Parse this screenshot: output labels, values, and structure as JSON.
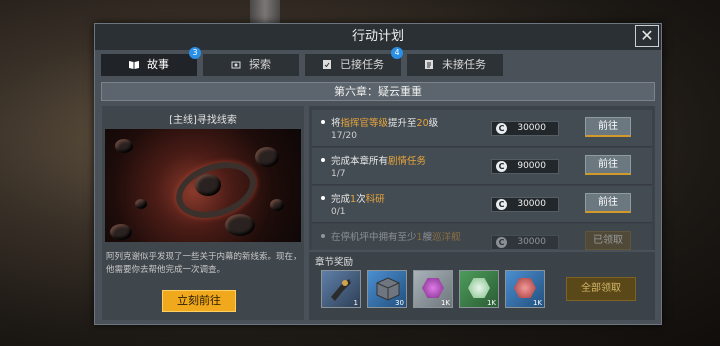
{
  "window": {
    "title": "行动计划",
    "close_icon": "close-icon"
  },
  "tabs": [
    {
      "label": "故事",
      "icon": "book-icon",
      "badge": "3",
      "active": true
    },
    {
      "label": "探索",
      "icon": "explore-icon",
      "badge": "",
      "active": false
    },
    {
      "label": "已接任务",
      "icon": "clipboard-check-icon",
      "badge": "4",
      "active": false
    },
    {
      "label": "未接任务",
      "icon": "clipboard-list-icon",
      "badge": "",
      "active": false
    }
  ],
  "chapter": {
    "title": "第六章：疑云重重"
  },
  "story": {
    "title": "[主线]寻找线索",
    "description": "阿列克谢似乎发现了一些关于内幕的新线索。现在，他需要你去帮他完成一次调查。",
    "button": "立刻前往"
  },
  "quests": [
    {
      "pre": "将",
      "hl1": "指挥官等级",
      "mid": "提升至",
      "hl2": "20",
      "post": "级",
      "progress": "17/20",
      "reward": "30000",
      "button": "前往"
    },
    {
      "pre": "完成本章所有",
      "hl1": "剧情任务",
      "mid": "",
      "hl2": "",
      "post": "",
      "progress": "1/7",
      "reward": "90000",
      "button": "前往"
    },
    {
      "pre": "完成",
      "hl1": "1",
      "mid": "次",
      "hl2": "科研",
      "post": "",
      "progress": "0/1",
      "reward": "30000",
      "button": "前往"
    },
    {
      "pre": "在停机坪中拥有至少",
      "hl1": "1",
      "mid": "艘",
      "hl2": "巡洋舰",
      "post": "",
      "progress": "",
      "reward": "30000",
      "button": "已领取"
    }
  ],
  "currency_symbol": "C",
  "rewards": {
    "title": "章节奖励",
    "items": [
      {
        "icon": "weapon-part-icon",
        "count": "1",
        "color": "#4f6f99"
      },
      {
        "icon": "module-box-icon",
        "count": "30",
        "color": "#3e7fc2"
      },
      {
        "icon": "purple-crystal-icon",
        "count": "1K",
        "color": "#b04fb7"
      },
      {
        "icon": "green-crystal-icon",
        "count": "1K",
        "color": "#8fd19a"
      },
      {
        "icon": "red-crystal-icon",
        "count": "1K",
        "color": "#c65050"
      }
    ],
    "claim_all": "全部领取"
  },
  "colors": {
    "accent_orange": "#f0a81c",
    "badge_blue": "#2a8fe6",
    "highlight_text": "#e9a53a"
  }
}
